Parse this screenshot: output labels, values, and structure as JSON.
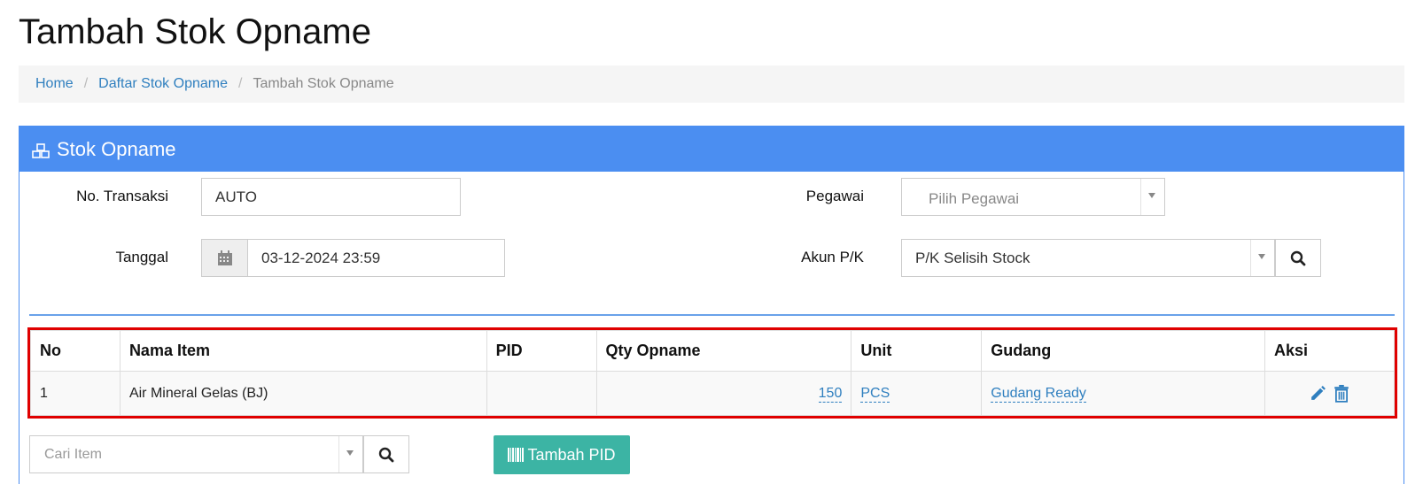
{
  "page": {
    "title": "Tambah Stok Opname"
  },
  "breadcrumb": {
    "items": [
      "Home",
      "Daftar Stok Opname",
      "Tambah Stok Opname"
    ]
  },
  "panel": {
    "title": "Stok Opname"
  },
  "form": {
    "no_transaksi": {
      "label": "No. Transaksi",
      "value": "AUTO"
    },
    "tanggal": {
      "label": "Tanggal",
      "value": "03-12-2024 23:59"
    },
    "pegawai": {
      "label": "Pegawai",
      "placeholder": "Pilih Pegawai"
    },
    "akun": {
      "label": "Akun P/K",
      "value": "P/K Selisih Stock"
    }
  },
  "table": {
    "headers": [
      "No",
      "Nama Item",
      "PID",
      "Qty Opname",
      "Unit",
      "Gudang",
      "Aksi"
    ],
    "rows": [
      {
        "no": "1",
        "nama_item": "Air Mineral Gelas (BJ)",
        "pid": "",
        "qty": "150",
        "unit": "PCS",
        "gudang": "Gudang Ready"
      }
    ]
  },
  "search": {
    "placeholder": "Cari Item"
  },
  "buttons": {
    "tambah_pid": "Tambah PID"
  },
  "colors": {
    "primary": "#4b8ef1",
    "link": "#2f7fbf",
    "teal": "#3cb4a4",
    "highlight": "#e00000"
  }
}
